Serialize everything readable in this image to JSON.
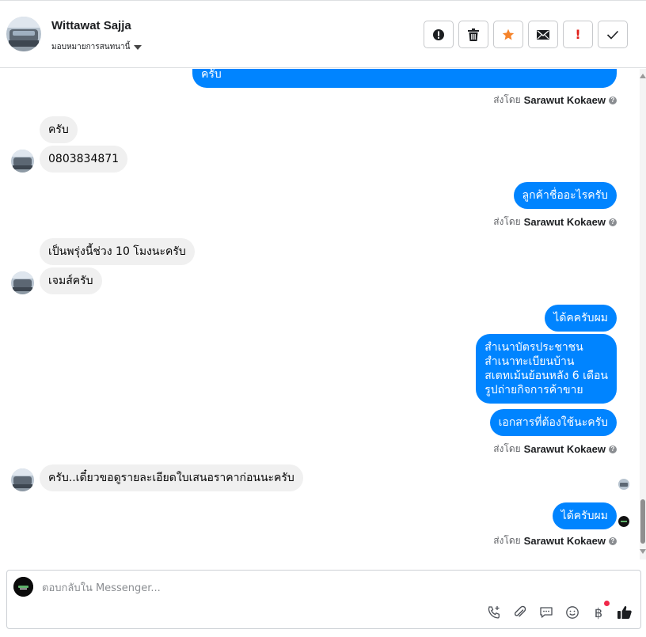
{
  "header": {
    "contact_name": "Wittawat Sajja",
    "assign_label": "มอบหมายการสนทนานี้",
    "actions": [
      {
        "name": "spam-button",
        "icon": "alert-circle-icon"
      },
      {
        "name": "delete-button",
        "icon": "trash-icon"
      },
      {
        "name": "star-button",
        "icon": "star-icon"
      },
      {
        "name": "mark-unread-button",
        "icon": "envelope-icon"
      },
      {
        "name": "follow-up-button",
        "icon": "exclamation-icon",
        "glyph": "!"
      },
      {
        "name": "mark-done-button",
        "icon": "check-icon"
      }
    ]
  },
  "messages": {
    "m1": "ครับ",
    "sent_by_1_prefix": "ส่งโดย",
    "sent_by_1_name": "Sarawut Kokaew",
    "m2": "ครับ",
    "m3": "0803834871",
    "m4": "ลูกค้าชื่ออะไรครับ",
    "sent_by_2_prefix": "ส่งโดย",
    "sent_by_2_name": "Sarawut Kokaew",
    "m5": "เป็นพรุ่งนี้ช่วง 10 โมงนะครับ",
    "m6": "เจมส์ครับ",
    "m7": "ได้คครับผม",
    "m8_line1": "สำเนาบัตรประชาชน",
    "m8_line2": "สำเนาทะเบียนบ้าน",
    "m8_line3": "สเตทเม้นย้อนหลัง 6 เดือน",
    "m8_line4": "รูปถ่ายกิจการค้าขาย",
    "m9": "เอกสารที่ต้องใช้นะครับ",
    "sent_by_3_prefix": "ส่งโดย",
    "sent_by_3_name": "Sarawut Kokaew",
    "m10": "ครับ..เดี๋ยวขอดูรายละเอียดใบเสนอราคาก่อนนะครับ",
    "m11": "ได้ครับผม",
    "sent_by_4_prefix": "ส่งโดย",
    "sent_by_4_name": "Sarawut Kokaew"
  },
  "composer": {
    "placeholder": "ตอบกลับใน Messenger...",
    "tools": [
      "phone-add-icon",
      "paperclip-icon",
      "chat-bubble-icon",
      "smiley-icon",
      "baht-icon",
      "thumbs-up-icon"
    ],
    "baht_glyph": "฿"
  },
  "colors": {
    "outgoing": "#0084ff",
    "incoming": "#f0f0f0",
    "star": "#f5832a",
    "follow_up": "#e0201a"
  }
}
